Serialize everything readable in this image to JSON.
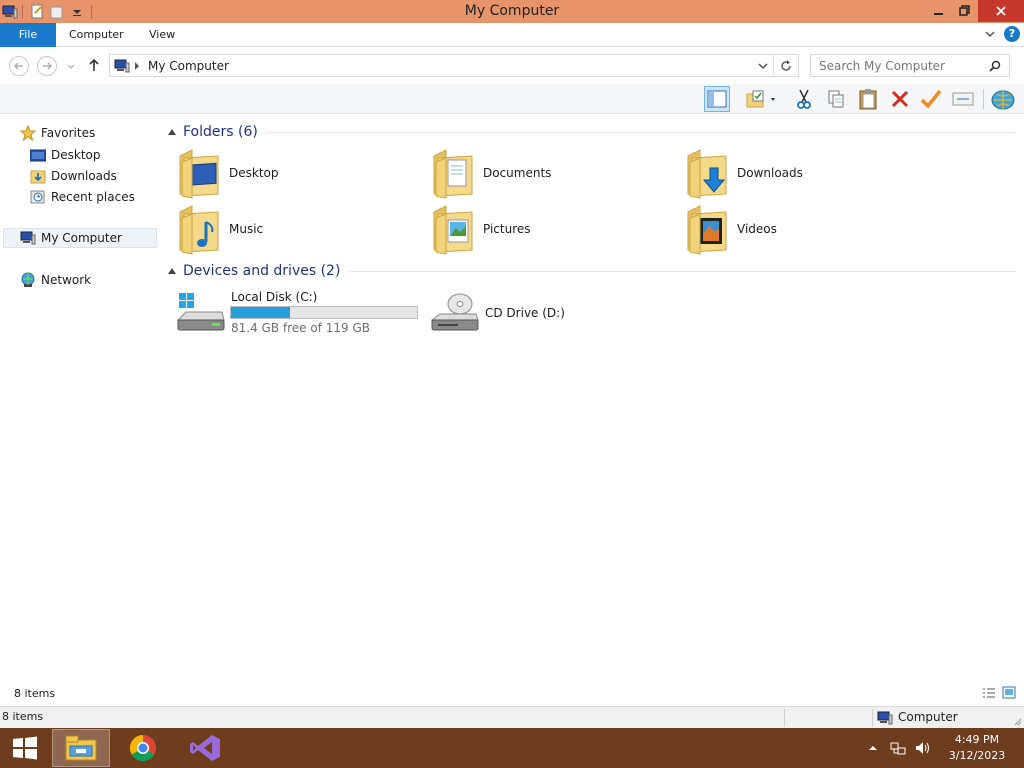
{
  "window": {
    "title": "My Computer"
  },
  "ribbon": {
    "tabs": [
      "File",
      "Computer",
      "View"
    ]
  },
  "address": {
    "path": "My Computer",
    "search_placeholder": "Search My Computer"
  },
  "nav": {
    "favorites": "Favorites",
    "items": [
      "Desktop",
      "Downloads",
      "Recent places"
    ],
    "computer": "My Computer",
    "network": "Network"
  },
  "content": {
    "folders_header": "Folders (6)",
    "folders": [
      "Desktop",
      "Documents",
      "Downloads",
      "Music",
      "Pictures",
      "Videos"
    ],
    "drives_header": "Devices and drives (2)",
    "drives": [
      {
        "name": "Local Disk (C:)",
        "free": "81.4 GB free of 119 GB",
        "used_fraction": 0.316
      },
      {
        "name": "CD Drive (D:)"
      }
    ]
  },
  "status": {
    "items_top": "8 items",
    "items_bottom": "8 items",
    "location": "Computer"
  },
  "taskbar": {
    "time": "4:49 PM",
    "date": "3/12/2023"
  },
  "colors": {
    "titlebar": "#e8946a",
    "file_tab": "#1979ca",
    "taskbar": "#6e3d1e",
    "close": "#c7382c"
  }
}
